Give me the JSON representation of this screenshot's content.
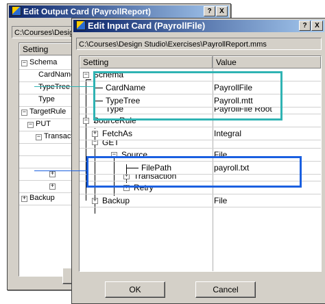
{
  "back_window": {
    "title": "Edit Output Card (PayrollReport)",
    "path": "C:\\Courses\\Design Studio\\Exercises\\PayrollReport.mms",
    "header_setting": "Setting",
    "rows": [
      "Schema",
      "CardName",
      "TypeTree",
      "Type",
      "TargetRule",
      "PUT",
      "Transaction",
      "Backup"
    ]
  },
  "front_window": {
    "title": "Edit Input Card (PayrollFile)",
    "help_btn": "?",
    "close_btn": "X",
    "path": "C:\\Courses\\Design Studio\\Exercises\\PayrollReport.mms",
    "header_setting": "Setting",
    "header_value": "Value",
    "rows": [
      {
        "label": "Schema",
        "value": ""
      },
      {
        "label": "CardName",
        "value": "PayrollFile"
      },
      {
        "label": "TypeTree",
        "value": "Payroll.mtt"
      },
      {
        "label": "Type",
        "value": "PayrollFile Root"
      },
      {
        "label": "SourceRule",
        "value": ""
      },
      {
        "label": "FetchAs",
        "value": "Integral"
      },
      {
        "label": "GET",
        "value": ""
      },
      {
        "label": "Source",
        "value": "File"
      },
      {
        "label": "FilePath",
        "value": "payroll.txt"
      },
      {
        "label": "Transaction",
        "value": ""
      },
      {
        "label": "Retry",
        "value": ""
      },
      {
        "label": "Backup",
        "value": "File"
      }
    ],
    "ok_label": "OK",
    "cancel_label": "Cancel"
  },
  "colors": {
    "highlight_teal": "#2fb3b3",
    "highlight_blue": "#1a5fe0"
  }
}
